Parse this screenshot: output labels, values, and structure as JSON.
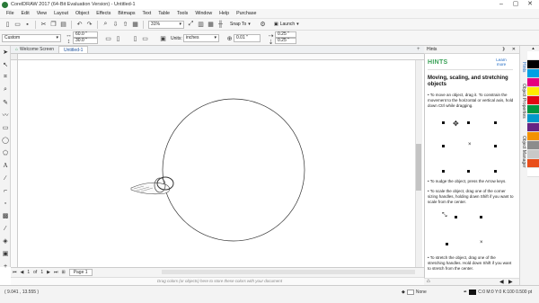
{
  "window": {
    "title": "CorelDRAW 2017 (64-Bit Evaluation Version) - Untitled-1",
    "controls": [
      "minimize-icon",
      "maximize-icon",
      "close-icon"
    ]
  },
  "menu": [
    "File",
    "Edit",
    "View",
    "Layout",
    "Object",
    "Effects",
    "Bitmaps",
    "Text",
    "Table",
    "Tools",
    "Window",
    "Help",
    "Purchase"
  ],
  "standard_toolbar": {
    "zoom": "31%",
    "snap_to": "Snap To",
    "launch": "Launch"
  },
  "property_bar": {
    "page_preset": "Custom",
    "width": "60.0 \"",
    "height": "30.0 \"",
    "units_label": "Units:",
    "units": "inches",
    "nudge": "0.01 \"",
    "dup_x": "0.25 \"",
    "dup_y": "0.25 \""
  },
  "tabs": [
    {
      "label": "Welcome Screen",
      "active": false
    },
    {
      "label": "Untitled-1",
      "active": true
    }
  ],
  "page_nav": {
    "current": "1",
    "of": "of",
    "total": "1",
    "page_tab": "Page 1"
  },
  "document_palette_hint": "Drag colors (or objects) here to store these colors with your document",
  "hints_panel": {
    "header": "Hints",
    "section": "HINTS",
    "learn_more": "Learn more",
    "heading": "Moving, scaling, and stretching objects",
    "move": "• To move an object, drag it. To constrain the movement to the horizontal or vertical axis, hold down Ctrl while dragging.",
    "nudge": "• To nudge the object, press the Arrow keys.",
    "scale": "• To scale the object, drag one of the corner sizing handles, holding down Shift if you want to scale from the center.",
    "stretch": "• To stretch the object, drag one of the stretching handles. Hold down Shift if you want to stretch from the center."
  },
  "docker_tabs": [
    "Hints",
    "Object Properties",
    "Object Manager"
  ],
  "status": {
    "coords": "( 9.041 , 13.555 )",
    "fill": "None",
    "outline": "C:0 M:0 Y:0 K:100  0.500 pt"
  },
  "colors": {
    "accent": "#3aa157",
    "link": "#1a66c2",
    "palette": [
      "#ffffff",
      "#000000",
      "#00a0e3",
      "#e6007e",
      "#ffed00",
      "#e30613",
      "#009640",
      "#0099cc",
      "#662483",
      "#f39200",
      "#8c8c8c",
      "#c8c8c8",
      "#e94e1b",
      "#ffffff"
    ]
  }
}
